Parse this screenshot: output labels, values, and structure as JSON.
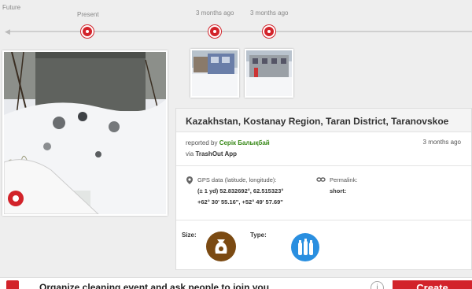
{
  "timeline": {
    "future_label": "Future",
    "present_label": "Present",
    "marker_1_label": "3 months ago",
    "marker_2_label": "3 months ago"
  },
  "report": {
    "title": "Kazakhstan, Kostanay Region, Taran District, Taranovskoe",
    "reported_by_prefix": "reported by",
    "reporter": "Серік Балықбай",
    "time_ago": "3 months ago",
    "via_prefix": "via",
    "via_app": "TrashOut App",
    "gps_label": "GPS data (latitude, longitude):",
    "gps_decimal": "(± 1 yd) 52.832692°, 62.515323°",
    "gps_dms": "+62° 30' 55.16\", +52° 49' 57.69\"",
    "permalink_label": "Permalink:",
    "short_label": "short:",
    "size_label": "Size:",
    "type_label": "Type:"
  },
  "bottom": {
    "organize_text": "Organize cleaning event and ask people to join you",
    "info_glyph": "i",
    "create_label": "Create"
  },
  "icons": {
    "gps": "gps-pin-icon",
    "permalink": "link-icon",
    "size": "trash-bag-icon",
    "type": "plastic-bottles-icon"
  },
  "colors": {
    "accent_red": "#d2232a",
    "reporter_green": "#3a8a1a",
    "size_brown": "#7b4a12",
    "type_blue": "#2a8fe0"
  }
}
